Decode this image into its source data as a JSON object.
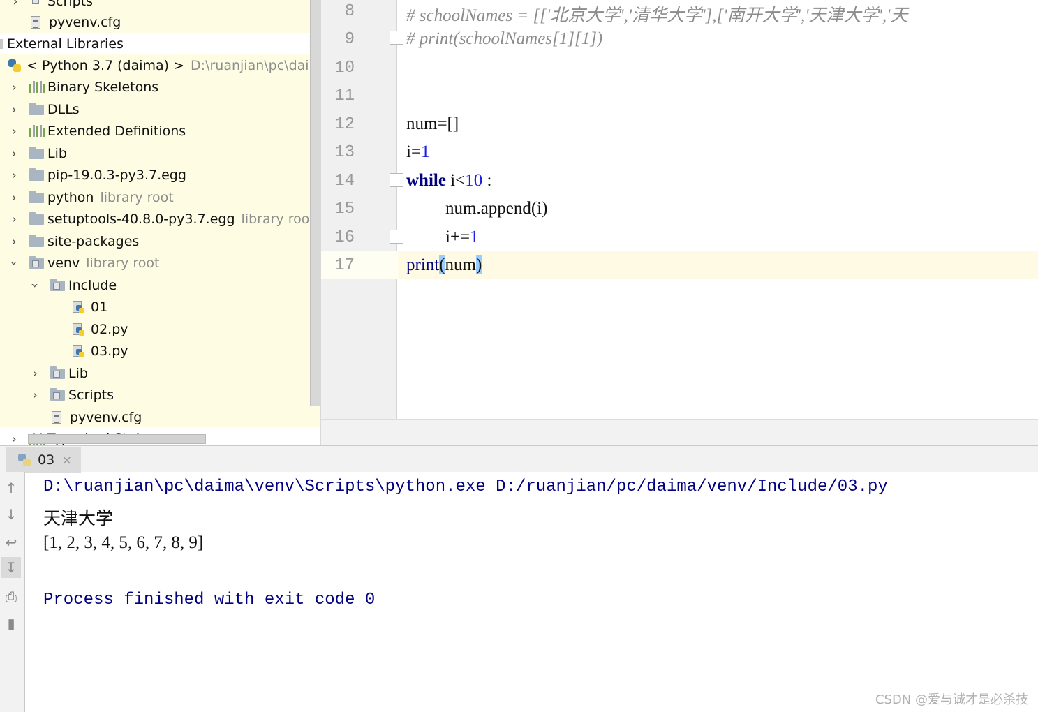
{
  "project_tree": {
    "rows": [
      {
        "label": "Scripts",
        "icon": "folder-icon"
      },
      {
        "label": "pyvenv.cfg",
        "icon": "config-file-icon"
      },
      {
        "label": "External Libraries",
        "icon": "library-icon"
      },
      {
        "label": "< Python 3.7 (daima) >",
        "hint": "D:\\ruanjian\\pc\\daima\\ve",
        "icon": "python-icon"
      },
      {
        "label": "Binary Skeletons",
        "icon": "library-icon"
      },
      {
        "label": "DLLs",
        "icon": "folder-icon"
      },
      {
        "label": "Extended Definitions",
        "icon": "library-icon"
      },
      {
        "label": "Lib",
        "icon": "folder-icon"
      },
      {
        "label": "pip-19.0.3-py3.7.egg",
        "icon": "folder-icon"
      },
      {
        "label": "python",
        "hint": "library root",
        "icon": "folder-icon"
      },
      {
        "label": "setuptools-40.8.0-py3.7.egg",
        "hint": "library root",
        "icon": "folder-icon"
      },
      {
        "label": "site-packages",
        "icon": "folder-icon"
      },
      {
        "label": "venv",
        "hint": "library root",
        "icon": "folder-icon"
      },
      {
        "label": "Include",
        "icon": "folder-icon"
      },
      {
        "label": "01",
        "icon": "python-file-icon"
      },
      {
        "label": "02.py",
        "icon": "python-file-icon"
      },
      {
        "label": "03.py",
        "icon": "python-file-icon"
      },
      {
        "label": "Lib",
        "icon": "folder-icon"
      },
      {
        "label": "Scripts",
        "icon": "folder-icon"
      },
      {
        "label": "pyvenv.cfg",
        "icon": "config-file-icon"
      },
      {
        "label": "Typeshed Stubs",
        "icon": "library-icon"
      }
    ]
  },
  "editor": {
    "line_numbers": [
      "8",
      "9",
      "10",
      "11",
      "12",
      "13",
      "14",
      "15",
      "16",
      "17"
    ],
    "lines": {
      "l8_comment": "# schoolNames = [['北京大学','清华大学'],['南开大学','天津大学','天",
      "l9_comment": "# print(schoolNames[1][1])",
      "l12": "num=[]",
      "l13_var": "i=",
      "l13_num": "1",
      "l14_kw": "while",
      "l14_mid": " i<",
      "l14_num": "10",
      "l14_end": " :",
      "l15": "num.append(i)",
      "l16_var": "i+=",
      "l16_num": "1",
      "l17_fn": "print",
      "l17_open": "(",
      "l17_arg": "num",
      "l17_close": ")"
    }
  },
  "run_panel": {
    "tab_label": "03",
    "tab_close": "×",
    "console": {
      "command": "D:\\ruanjian\\pc\\daima\\venv\\Scripts\\python.exe D:/ruanjian/pc/daima/venv/Include/03.py",
      "output_1": "天津大学",
      "output_2": "[1, 2, 3, 4, 5, 6, 7, 8, 9]",
      "exit_message": "Process finished with exit code 0"
    },
    "toolbar": [
      "up-arrow-icon",
      "down-arrow-icon",
      "soft-wrap-icon",
      "scroll-to-end-icon",
      "print-icon",
      "trash-icon"
    ]
  },
  "watermark": "CSDN @爱与诚才是必杀技",
  "colors": {
    "project_bg": "#fefde3",
    "keyword": "#000080",
    "number": "#1f1fe0",
    "comment": "#8c8c8c",
    "brace_match": "#99ccff",
    "caret_line": "#fffae3"
  }
}
